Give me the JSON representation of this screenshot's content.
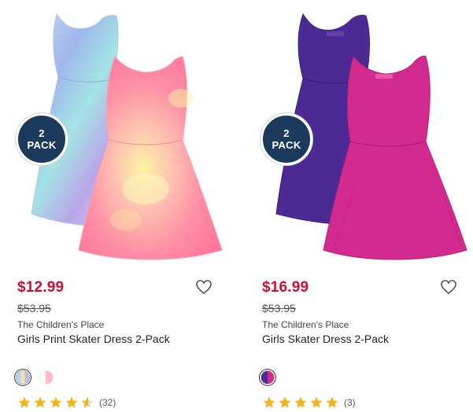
{
  "colors": {
    "price_red": "#c8102e",
    "badge_navy": "#1b3a5c",
    "star_gold": "#f2b51d"
  },
  "products": [
    {
      "badge_line1": "2",
      "badge_line2": "PACK",
      "price": "$12.99",
      "original_price": "$53.95",
      "brand": "The Children's Place",
      "name": "Girls Print Skater Dress 2-Pack",
      "rating": 4.5,
      "review_count": "(32)",
      "swatch_colors": [
        "tie-dye pastel multi",
        "pink tie-dye"
      ]
    },
    {
      "badge_line1": "2",
      "badge_line2": "PACK",
      "price": "$16.99",
      "original_price": "$53.95",
      "brand": "The Children's Place",
      "name": "Girls Skater Dress 2-Pack",
      "rating": 5,
      "review_count": "(3)",
      "swatch_colors": [
        "purple/pink"
      ]
    }
  ],
  "icons": {
    "wishlist": "heart-outline-icon",
    "rating": "star-icon"
  }
}
